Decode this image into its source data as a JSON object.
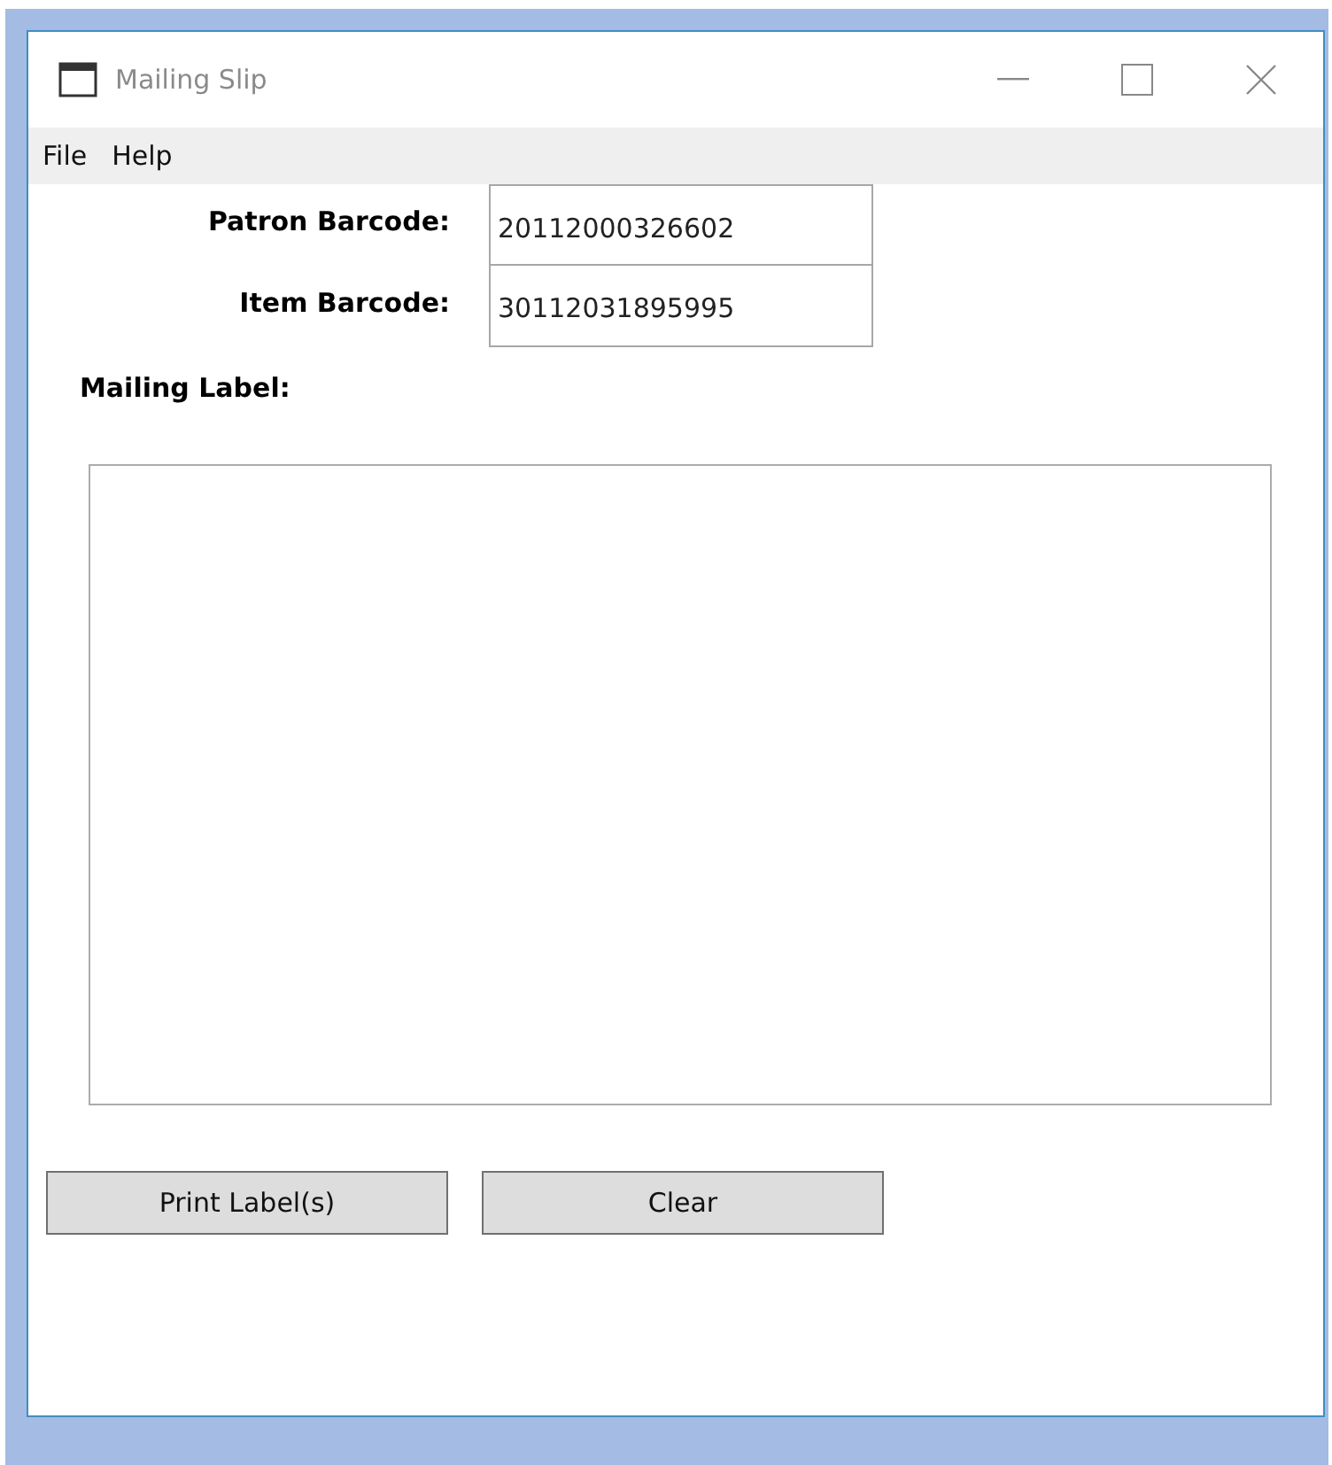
{
  "window": {
    "title": "Mailing Slip"
  },
  "menu": [
    "File",
    "Help"
  ],
  "fields": [
    {
      "label": "Patron Barcode:",
      "value": "20112000326602"
    },
    {
      "label": "Item Barcode:",
      "value": "30112031895995"
    }
  ],
  "mailing_label": {
    "label": "Mailing Label:"
  },
  "buttons": [
    "Print Label(s)",
    "Clear"
  ]
}
